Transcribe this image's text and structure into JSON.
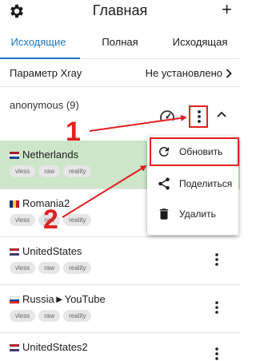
{
  "header": {
    "title": "Главная",
    "settings_icon": "gear-icon",
    "add_icon": "plus-icon"
  },
  "tabs": [
    {
      "label": "Исходящие",
      "active": true
    },
    {
      "label": "Полная",
      "active": false
    },
    {
      "label": "Исходящая",
      "active": false
    }
  ],
  "xray_param": {
    "label": "Параметр Xray",
    "value": "Не установлено"
  },
  "group": {
    "title": "anonymous (9)"
  },
  "servers": [
    {
      "name": "Netherlands",
      "flag": "nl",
      "tags": [
        "vless",
        "raw",
        "reality"
      ],
      "selected": true
    },
    {
      "name": "Romania2",
      "flag": "ro",
      "tags": [
        "vless",
        "raw",
        "reality"
      ],
      "selected": false
    },
    {
      "name": "UnitedStates",
      "flag": "us",
      "tags": [
        "vless",
        "raw",
        "reality"
      ],
      "selected": false
    },
    {
      "name": "Russia►YouTube",
      "flag": "ru",
      "tags": [
        "vless",
        "raw",
        "reality"
      ],
      "selected": false
    },
    {
      "name": "UnitedStates2",
      "flag": "us",
      "tags": [],
      "selected": false
    }
  ],
  "context_menu": [
    {
      "label": "Обновить",
      "icon": "refresh-icon",
      "highlighted": true
    },
    {
      "label": "Поделиться",
      "icon": "share-icon",
      "highlighted": false
    },
    {
      "label": "Удалить",
      "icon": "trash-icon",
      "highlighted": false
    }
  ],
  "annotations": {
    "step1": "1",
    "step2": "2",
    "color": "#e02020"
  },
  "colors": {
    "accent": "#1976c4",
    "selected_row": "#cde6c9"
  }
}
